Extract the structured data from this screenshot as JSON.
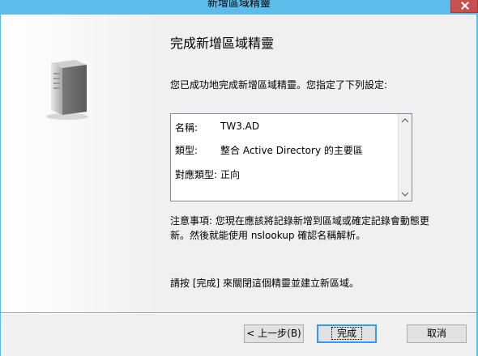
{
  "window": {
    "title": "新增區域精靈"
  },
  "page": {
    "heading": "完成新增區域精靈",
    "intro": "您已成功地完成新增區域精靈。您指定了下列設定:",
    "summary": [
      {
        "label": "名稱:",
        "value": "TW3.AD"
      },
      {
        "label": "類型:",
        "value": "整合 Active Directory 的主要區"
      },
      {
        "label": "對應類型:",
        "value": "正向"
      }
    ],
    "note": "注意事項: 您現在應該將記錄新增到區域或確定記錄會動態更新。然後就能使用 nslookup 確認名稱解析。",
    "finish_note": "請按 [完成] 來關閉這個精靈並建立新區域。"
  },
  "buttons": {
    "back": "< 上一步(B)",
    "finish": "完成",
    "cancel": "取消"
  },
  "icons": {
    "wizard_graphic": "server-icon",
    "close": "close-icon",
    "scroll_up": "chevron-up-icon",
    "scroll_down": "chevron-down-icon"
  },
  "colors": {
    "titlebar": "#5cbcea",
    "close_button": "#c75050",
    "default_button_border": "#3399ff"
  }
}
